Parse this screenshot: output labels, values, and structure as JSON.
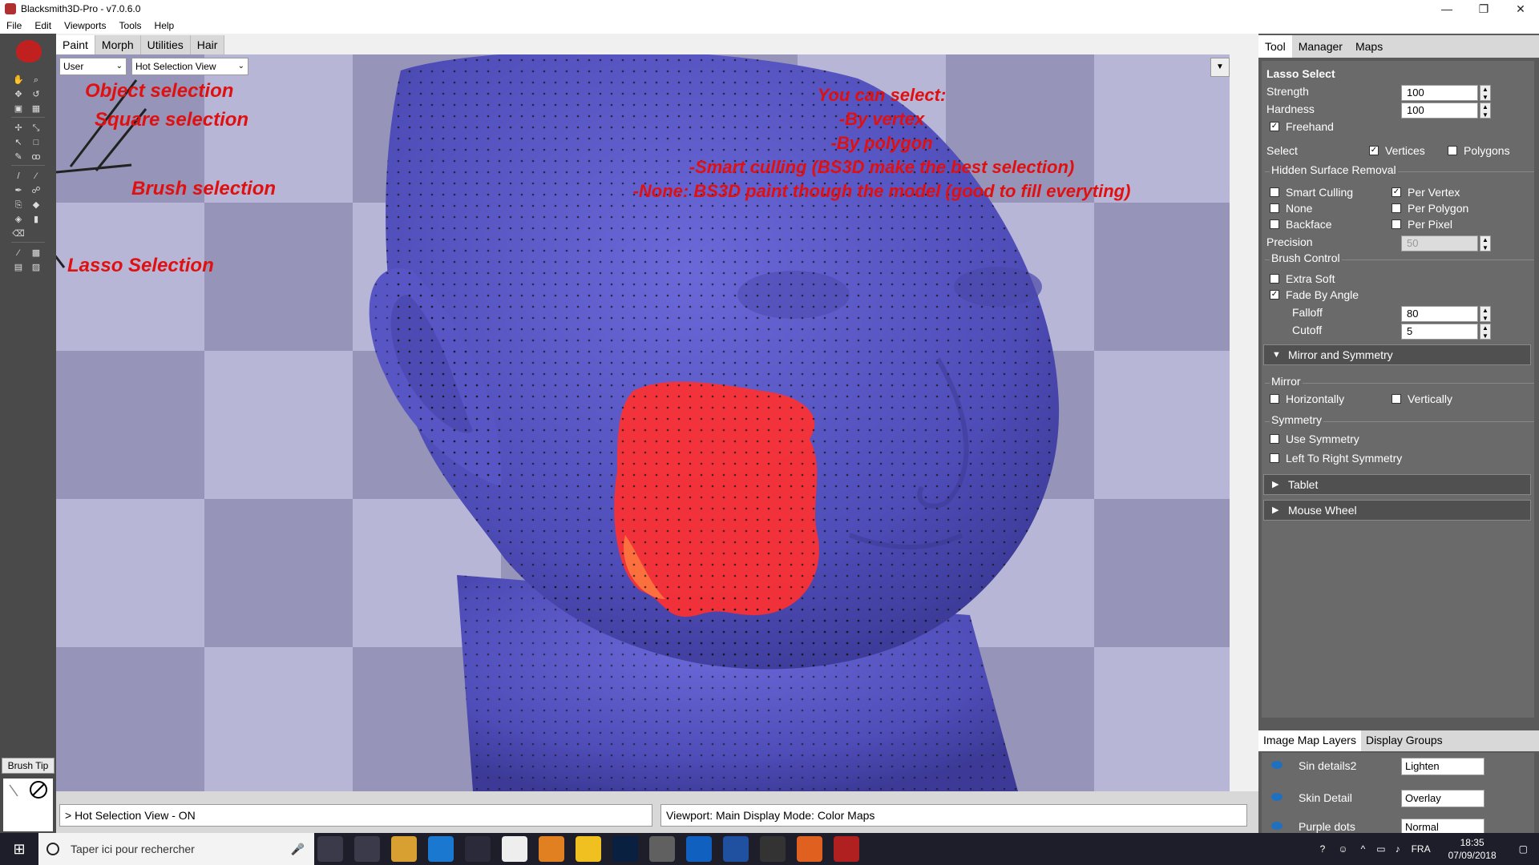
{
  "window": {
    "title": "Blacksmith3D-Pro - v7.0.6.0",
    "controls": [
      "—",
      "❐",
      "✕"
    ]
  },
  "menu": [
    "File",
    "Edit",
    "Viewports",
    "Tools",
    "Help"
  ],
  "top_tabs": [
    "Paint",
    "Morph",
    "Utilities",
    "Hair"
  ],
  "viewport": {
    "user_dropdown": "User",
    "view_dropdown": "Hot Selection View",
    "annotations": {
      "object": "Object selection",
      "square": "Square selection",
      "brush": "Brush selection",
      "lasso": "Lasso Selection",
      "select_lines": [
        "You can select:",
        "-By vertex",
        "-By polygon",
        "-Smart culling (BS3D make the best selection)",
        "-None: BS3D paint though the model (good to fill everyting)"
      ]
    }
  },
  "left_toolbar": {
    "brush_tip_label": "Brush Tip",
    "current_color": "#ff0000"
  },
  "status": {
    "left": "> Hot Selection View -  ON",
    "right": "Viewport: Main Display Mode: Color Maps"
  },
  "right_panel": {
    "tabs": [
      "Tool",
      "Manager",
      "Maps"
    ],
    "section_title": "Lasso Select",
    "strength_label": "Strength",
    "strength_value": "100",
    "hardness_label": "Hardness",
    "hardness_value": "100",
    "freehand_label": "Freehand",
    "select_label": "Select",
    "vertices_label": "Vertices",
    "polygons_label": "Polygons",
    "hsr_label": "Hidden Surface Removal",
    "smart_culling_label": "Smart Culling",
    "none_label": "None",
    "backface_label": "Backface",
    "per_vertex_label": "Per Vertex",
    "per_polygon_label": "Per Polygon",
    "per_pixel_label": "Per Pixel",
    "precision_label": "Precision",
    "precision_value": "50",
    "brush_control_label": "Brush Control",
    "extra_soft_label": "Extra Soft",
    "fade_by_angle_label": "Fade By Angle",
    "falloff_label": "Falloff",
    "falloff_value": "80",
    "cutoff_label": "Cutoff",
    "cutoff_value": "5",
    "mirror_symmetry_label": "Mirror and Symmetry",
    "mirror_label": "Mirror",
    "horizontally_label": "Horizontally",
    "vertically_label": "Vertically",
    "symmetry_label": "Symmetry",
    "use_symmetry_label": "Use Symmetry",
    "ltr_symmetry_label": "Left To Right Symmetry",
    "tablet_label": "Tablet",
    "mouse_wheel_label": "Mouse Wheel",
    "layers_tabs": [
      "Image Map Layers",
      "Display Groups"
    ],
    "layers": [
      {
        "name": "Sin details2",
        "mode": "Lighten"
      },
      {
        "name": "Skin Detail",
        "mode": "Overlay"
      },
      {
        "name": "Purple dots",
        "mode": "Normal"
      }
    ]
  },
  "taskbar": {
    "search_placeholder": "Taper ici pour rechercher",
    "language": "FRA",
    "time": "18:35",
    "date": "07/09/2018"
  }
}
